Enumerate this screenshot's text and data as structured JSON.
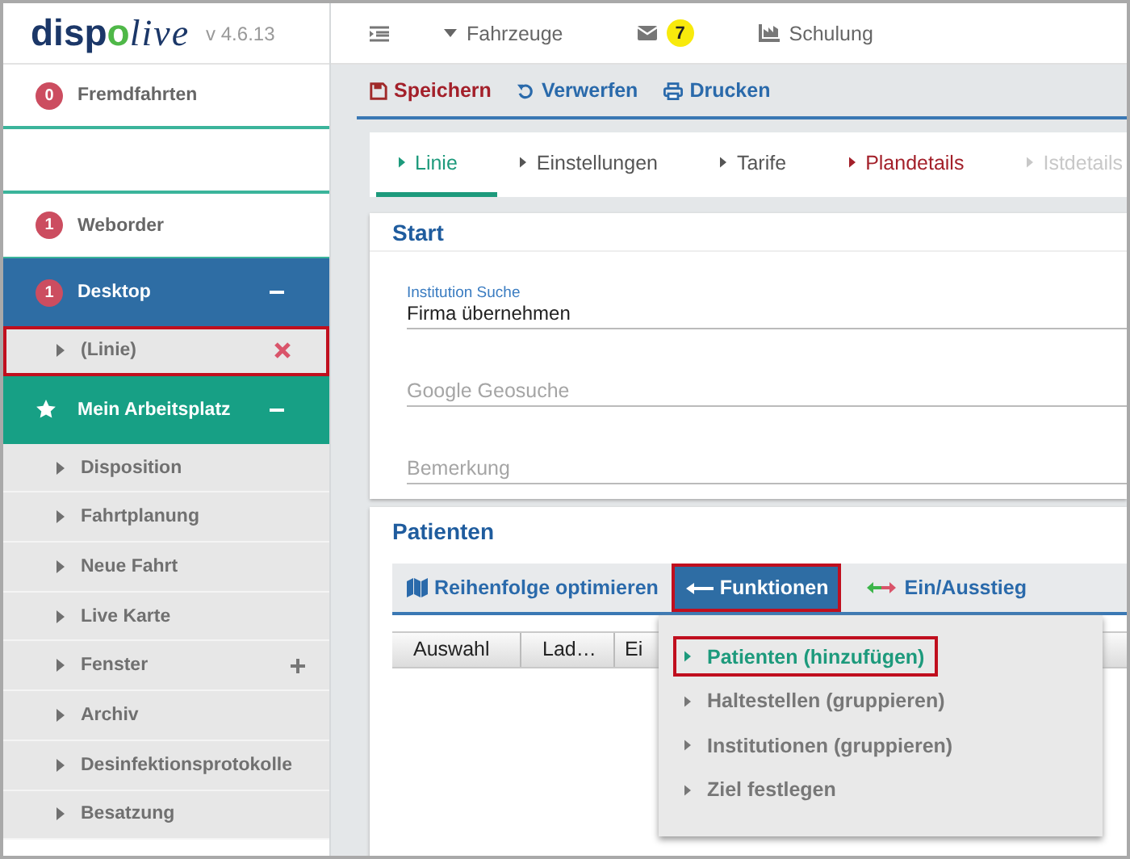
{
  "sidebar": {
    "logo": [
      {
        "text": "disp",
        "kind": "bold"
      },
      {
        "text": "o",
        "kind": "accent"
      },
      {
        "text": "live",
        "kind": "script"
      }
    ],
    "version": "v 4.6.13",
    "items": [
      {
        "kind": "counter",
        "label": "Fremdfahrten",
        "badge": "0"
      },
      {
        "kind": "blank"
      },
      {
        "kind": "counter",
        "label": "Weborder",
        "badge": "1"
      },
      {
        "kind": "group",
        "label": "Desktop",
        "badge": "1",
        "color": "#2e6da4",
        "expanded": true,
        "children": [
          {
            "label": "(Linie)",
            "closable": true,
            "expandable": false,
            "highlighted": true
          }
        ]
      },
      {
        "kind": "group",
        "label": "Mein Arbeitsplatz",
        "color": "#17a085",
        "expanded": true,
        "children": [
          {
            "label": "Disposition",
            "closable": false,
            "expandable": false,
            "highlighted": false
          },
          {
            "label": "Fahrtplanung",
            "closable": false,
            "expandable": false,
            "highlighted": false
          },
          {
            "label": "Neue Fahrt",
            "closable": false,
            "expandable": false,
            "highlighted": false
          },
          {
            "label": "Live Karte",
            "closable": false,
            "expandable": false,
            "highlighted": false
          },
          {
            "label": "Fenster",
            "closable": false,
            "expandable": true,
            "highlighted": false
          },
          {
            "label": "Archiv",
            "closable": false,
            "expandable": false,
            "highlighted": false
          },
          {
            "label": "Desinfektionsprotokolle",
            "closable": false,
            "expandable": false,
            "highlighted": false
          },
          {
            "label": "Besatzung",
            "closable": false,
            "expandable": false,
            "highlighted": false
          }
        ]
      }
    ]
  },
  "topnav": [
    {
      "kind": "toggle"
    },
    {
      "kind": "dropdown",
      "label": "Fahrzeuge"
    },
    {
      "kind": "mail",
      "badge": "7"
    },
    {
      "kind": "chart",
      "label": "Schulung"
    }
  ],
  "toolbar": [
    {
      "kind": "save",
      "label": "Speichern"
    },
    {
      "kind": "undo",
      "label": "Verwerfen"
    },
    {
      "kind": "print",
      "label": "Drucken"
    }
  ],
  "tabs": [
    {
      "label": "Linie",
      "selected": true,
      "kind": "normal"
    },
    {
      "label": "Einstellungen",
      "selected": false,
      "kind": "normal"
    },
    {
      "label": "Tarife",
      "selected": false,
      "kind": "normal"
    },
    {
      "label": "Plandetails",
      "selected": false,
      "kind": "warning"
    },
    {
      "label": "Istdetails",
      "selected": false,
      "kind": "disabled"
    }
  ],
  "start": {
    "title": "Start",
    "fields": [
      {
        "label": "Institution Suche",
        "value": "Firma übernehmen"
      },
      {
        "placeholder": "Google Geosuche"
      },
      {
        "placeholder": "Bemerkung"
      }
    ]
  },
  "patients": {
    "title": "Patienten",
    "actions": [
      {
        "kind": "map",
        "label": "Reihenfolge optimieren",
        "highlighted": false
      },
      {
        "kind": "menu",
        "label": "Funktionen",
        "highlighted": true,
        "expanded": true
      },
      {
        "kind": "swap",
        "label": "Ein/Ausstieg",
        "highlighted": false
      }
    ],
    "columns": [
      "Auswahl",
      "Lad…",
      "Ei"
    ],
    "menu": [
      {
        "label": "Patienten (hinzufügen)",
        "selected": true,
        "highlighted": true
      },
      {
        "label": "Haltestellen (gruppieren)",
        "selected": false,
        "highlighted": false
      },
      {
        "label": "Institutionen (gruppieren)",
        "selected": false,
        "highlighted": false
      },
      {
        "label": "Ziel festlegen",
        "selected": false,
        "highlighted": false
      }
    ]
  }
}
